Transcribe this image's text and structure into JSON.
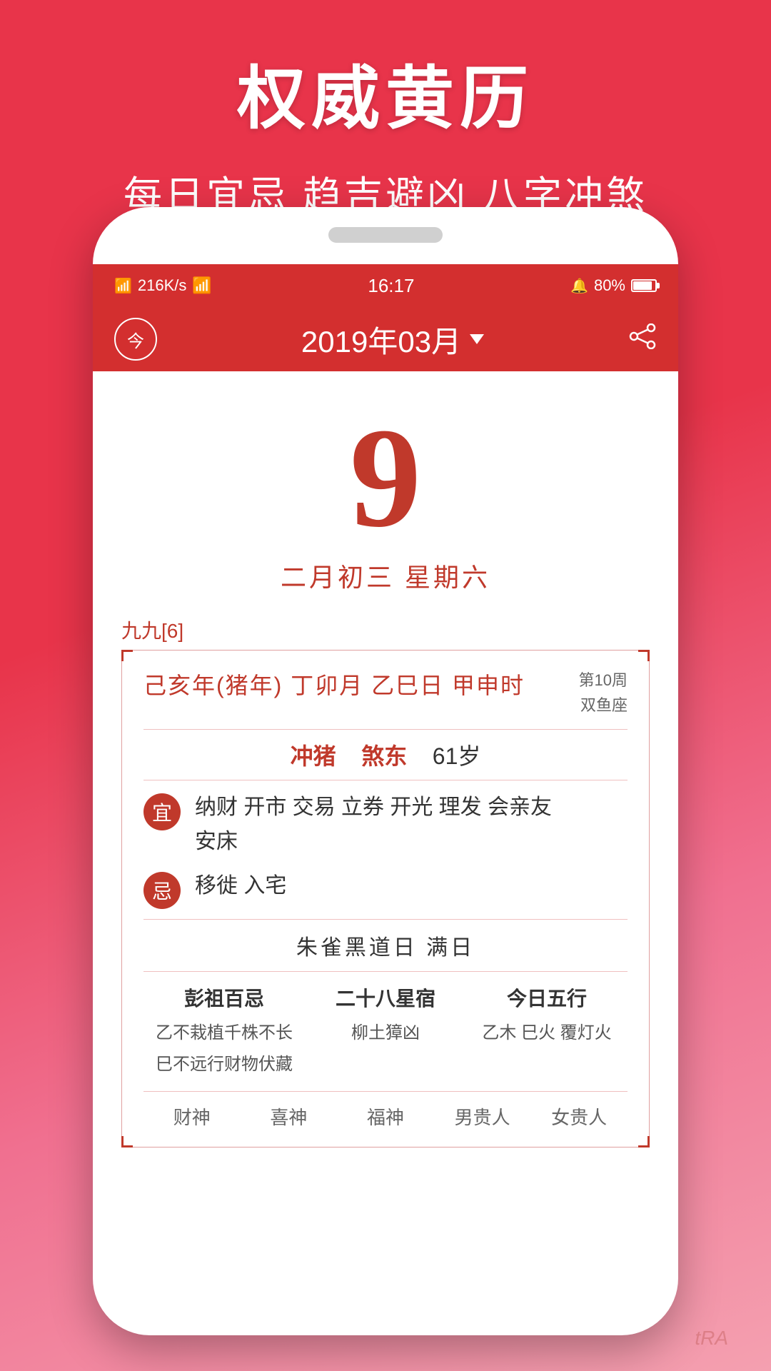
{
  "background": {
    "gradient_start": "#e8344a",
    "gradient_end": "#f4a0b0"
  },
  "top_section": {
    "main_title": "权威黄历",
    "sub_title": "每日宜忌 趋吉避凶 八字冲煞"
  },
  "status_bar": {
    "signal": "4G",
    "speed": "216K/s",
    "wifi": "WiFi",
    "time": "16:17",
    "alarm": "🔔",
    "battery_percent": "80%"
  },
  "app_header": {
    "today_label": "今",
    "month_display": "2019年03月",
    "share_icon": "share"
  },
  "date_display": {
    "day_number": "9",
    "lunar_date": "二月初三  星期六"
  },
  "info_section": {
    "jiujiu_label": "九九[6]",
    "trad_date": "己亥年(猪年) 丁卯月 乙巳日 甲申时",
    "week_zodiac_line1": "第10周",
    "week_zodiac_line2": "双鱼座",
    "chong_text": "冲猪",
    "sha_text": "煞东",
    "age_text": "61岁",
    "yi_label": "宜",
    "yi_content": "纳财 开市 交易 立券 开光 理发 会亲友\n安床",
    "ji_label": "忌",
    "ji_content": "移徙 入宅",
    "zhuri_text": "朱雀黑道日   满日",
    "peng_zu_title": "彭祖百忌",
    "peng_za_content_1": "乙不栽植千株不长",
    "peng_za_content_2": "巳不远行财物伏藏",
    "xiu_title": "二十八星宿",
    "xiu_content": "柳土獐凶",
    "wuxing_title": "今日五行",
    "wuxing_content": "乙木 巳火 覆灯火",
    "bottom_items": [
      "财神",
      "喜神",
      "福神",
      "男贵人",
      "女贵人"
    ]
  },
  "watermark": "tRA"
}
